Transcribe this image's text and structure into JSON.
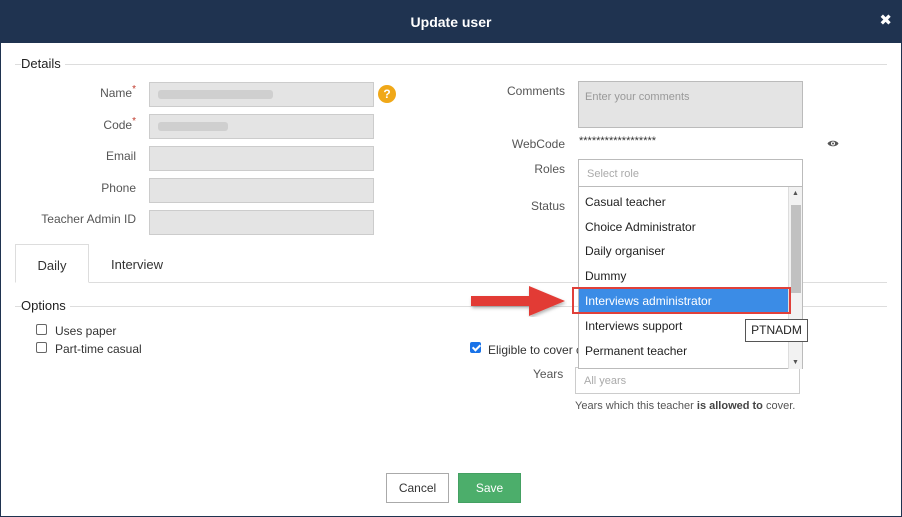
{
  "dialog": {
    "title": "Update user"
  },
  "details": {
    "legend": "Details",
    "name_label": "Name",
    "code_label": "Code",
    "email_label": "Email",
    "phone_label": "Phone",
    "teacher_admin_label": "Teacher Admin ID",
    "required_mark": "*",
    "help_glyph": "?",
    "comments_label": "Comments",
    "comments_placeholder": "Enter your comments",
    "webcode_label": "WebCode",
    "webcode_value": "******************",
    "roles_label": "Roles",
    "roles_placeholder": "Select role",
    "status_label": "Status"
  },
  "roles_dropdown": {
    "items": [
      "Casual teacher",
      "Choice Administrator",
      "Daily organiser",
      "Dummy",
      "Interviews administrator",
      "Interviews support",
      "Permanent teacher"
    ],
    "active_index": 4,
    "tooltip": "PTNADM"
  },
  "tabs": [
    {
      "label": "Daily",
      "active": true
    },
    {
      "label": "Interview",
      "active": false
    }
  ],
  "options": {
    "legend": "Options",
    "uses_paper": {
      "label": "Uses paper",
      "checked": false
    },
    "part_time_casual": {
      "label": "Part-time casual",
      "checked": false
    },
    "eligible": {
      "label": "Eligible to cover c",
      "checked": true
    },
    "years_label": "Years",
    "years_placeholder": "All years",
    "years_help_1": "Years which this teacher ",
    "years_help_bold": "is allowed to",
    "years_help_2": " cover."
  },
  "buttons": {
    "cancel": "Cancel",
    "save": "Save"
  },
  "icons": {
    "close": "close-icon",
    "help": "help-icon",
    "eye": "eye-icon",
    "arrow": "red-arrow-icon"
  },
  "colors": {
    "header": "#1f3350",
    "selected_role": "#3b8ce6",
    "save": "#4cae6b",
    "highlight": "#e0403a",
    "help": "#f0a818"
  }
}
